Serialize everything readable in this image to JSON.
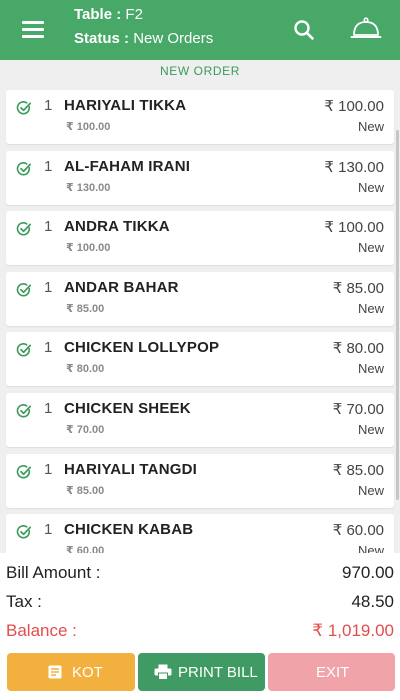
{
  "header": {
    "table_label": "Table :",
    "table_value": "F2",
    "status_label": "Status :",
    "status_value": "New Orders"
  },
  "section_title": "NEW ORDER",
  "currency_symbol": "₹",
  "items": [
    {
      "qty": "1",
      "name": "HARIYALI TIKKA",
      "price": "₹ 100.00",
      "unit_price": "₹ 100.00",
      "status": "New"
    },
    {
      "qty": "1",
      "name": "AL-FAHAM IRANI",
      "price": "₹ 130.00",
      "unit_price": "₹ 130.00",
      "status": "New"
    },
    {
      "qty": "1",
      "name": "ANDRA TIKKA",
      "price": "₹ 100.00",
      "unit_price": "₹ 100.00",
      "status": "New"
    },
    {
      "qty": "1",
      "name": "ANDAR BAHAR",
      "price": "₹ 85.00",
      "unit_price": "₹ 85.00",
      "status": "New"
    },
    {
      "qty": "1",
      "name": "CHICKEN LOLLYPOP",
      "price": "₹ 80.00",
      "unit_price": "₹ 80.00",
      "status": "New"
    },
    {
      "qty": "1",
      "name": "CHICKEN SHEEK",
      "price": "₹ 70.00",
      "unit_price": "₹ 70.00",
      "status": "New"
    },
    {
      "qty": "1",
      "name": "HARIYALI TANGDI",
      "price": "₹ 85.00",
      "unit_price": "₹ 85.00",
      "status": "New"
    },
    {
      "qty": "1",
      "name": "CHICKEN KABAB",
      "price": "₹ 60.00",
      "unit_price": "₹ 60.00",
      "status": "New"
    }
  ],
  "summary": {
    "bill_label": "Bill Amount :",
    "bill_value": "970.00",
    "tax_label": "Tax :",
    "tax_value": "48.50",
    "balance_label": "Balance :",
    "balance_value": "₹ 1,019.00"
  },
  "buttons": {
    "kot": "KOT",
    "print_bill": "PRINT BILL",
    "exit": "EXIT"
  },
  "colors": {
    "header": "#48a868",
    "check": "#3a9a5a",
    "balance": "#e24d4d",
    "kot": "#f2b13f",
    "print": "#3f9a63",
    "exit": "#f0a4aa"
  },
  "icons": {
    "menu": "hamburger-menu-icon",
    "search": "search-icon",
    "orders": "cloche-icon",
    "check": "check-circle-icon",
    "kot": "document-icon",
    "print": "printer-icon"
  }
}
